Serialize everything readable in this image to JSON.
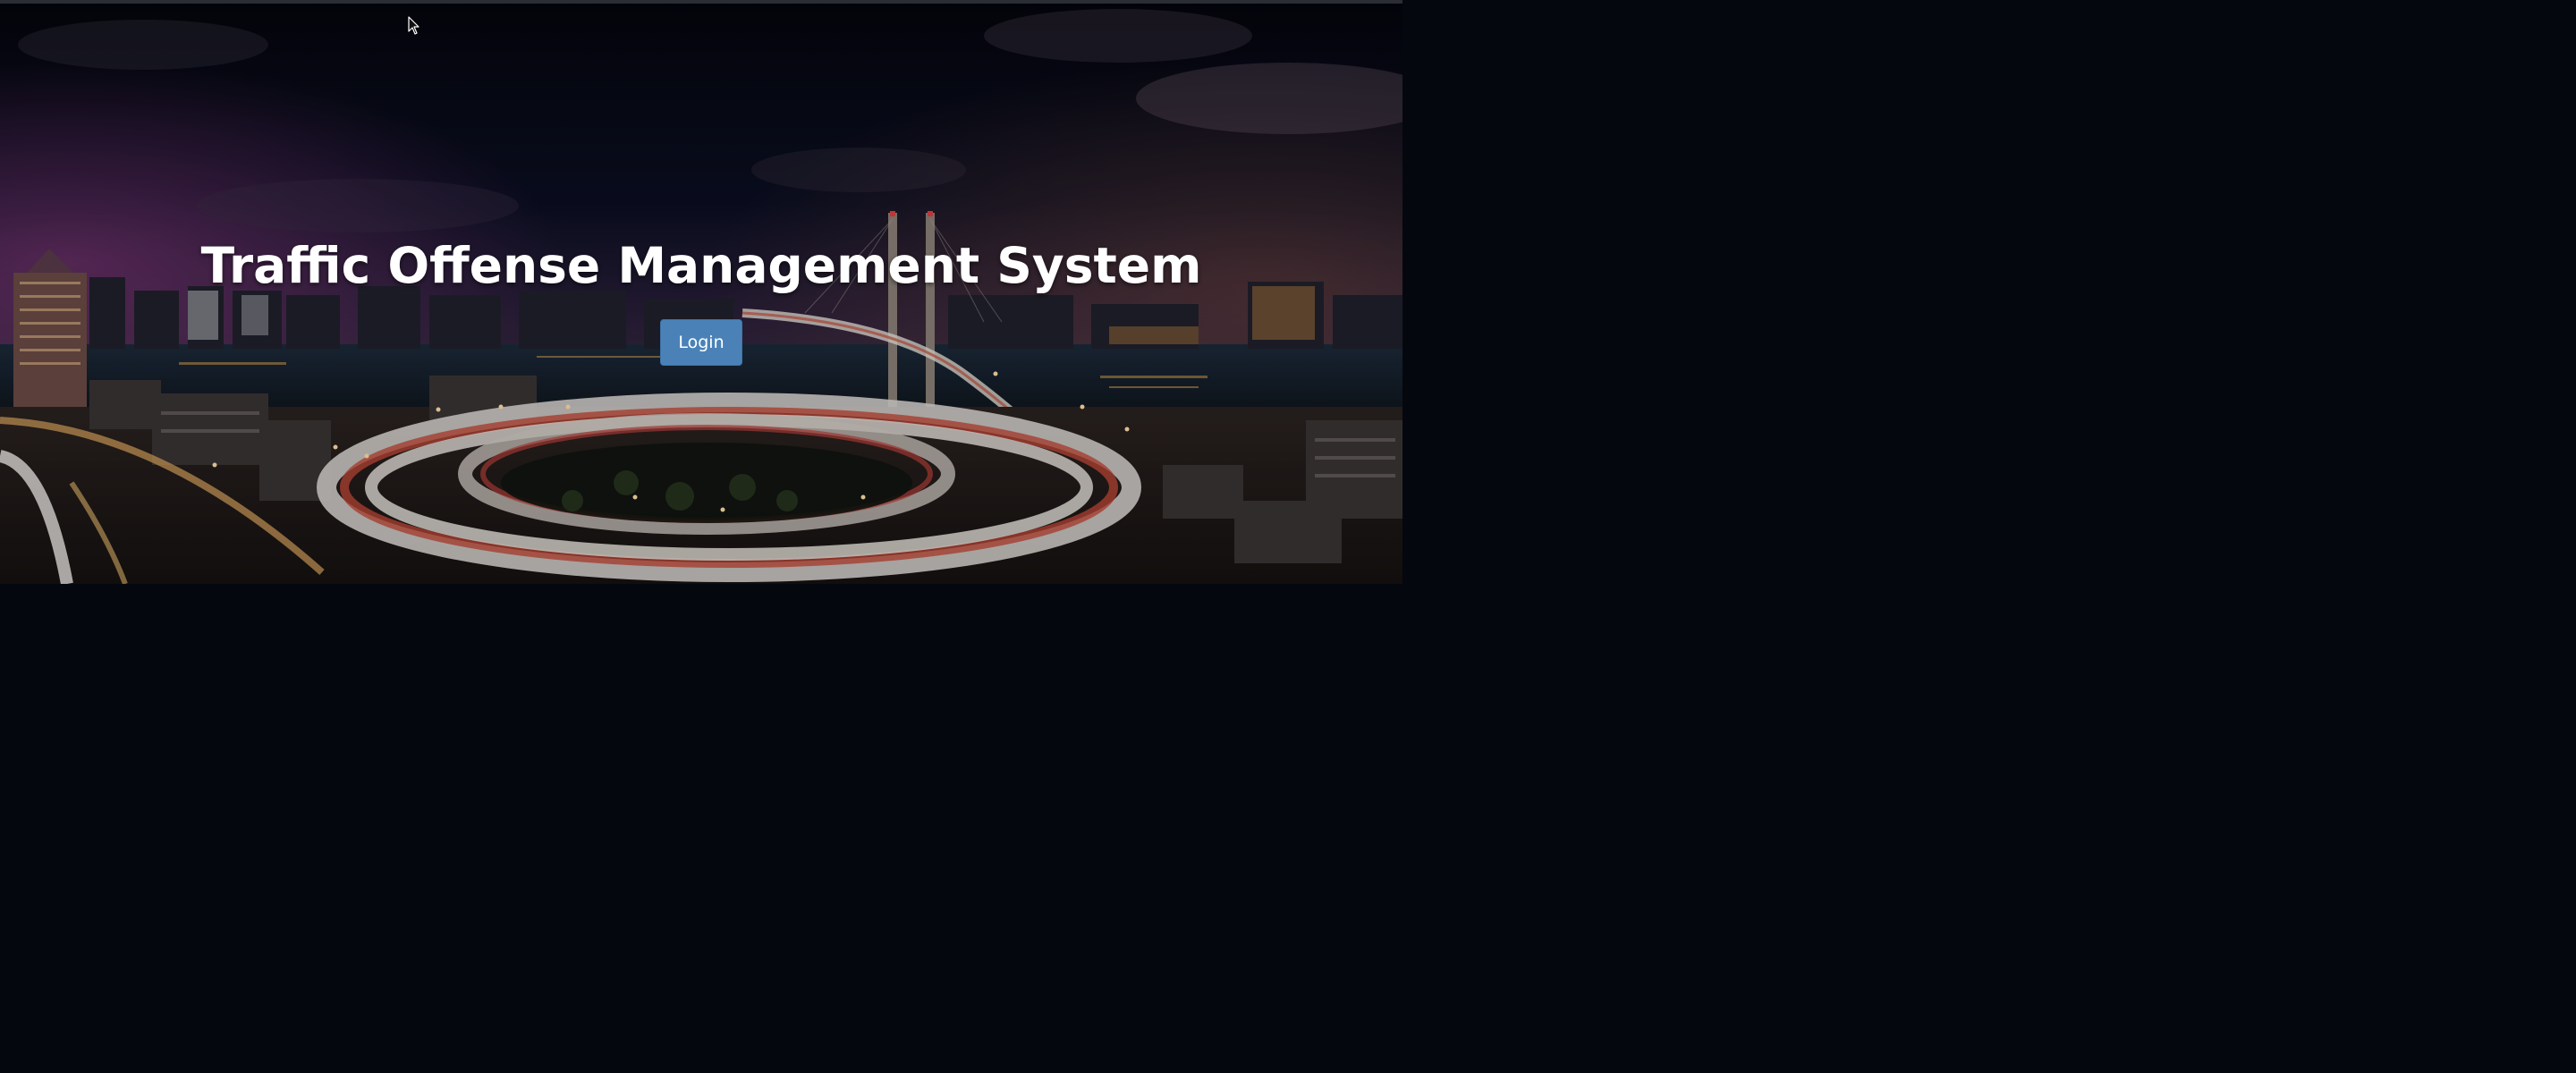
{
  "hero": {
    "title": "Traffic Offense Management System",
    "login_label": "Login"
  },
  "colors": {
    "button_bg": "#4a82b8",
    "title_text": "#ffffff",
    "sky_top": "#05070f",
    "city_lights": "#f2a64a"
  },
  "icons": {
    "cursor": "mouse-pointer-icon"
  }
}
